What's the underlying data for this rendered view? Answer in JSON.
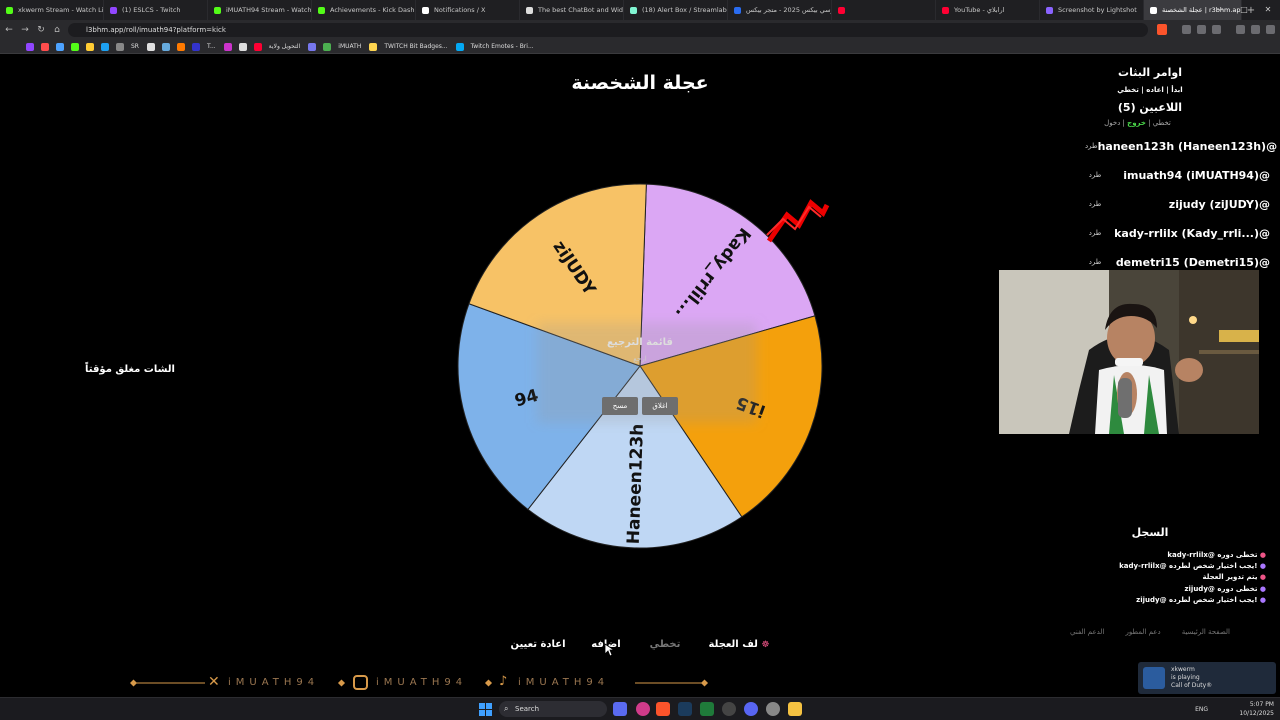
{
  "browser": {
    "tabs": [
      {
        "label": "xkwerm Stream - Watch Live",
        "color": "#53fc18"
      },
      {
        "label": "(1) ESLCS - Twitch",
        "color": "#9146ff"
      },
      {
        "label": "iMUATH94 Stream - Watch",
        "color": "#53fc18"
      },
      {
        "label": "Achievements - Kick Dashboard",
        "color": "#53fc18"
      },
      {
        "label": "Notifications / X",
        "color": "#ffffff"
      },
      {
        "label": "The best ChatBot and Widgets",
        "color": "#dddddd"
      },
      {
        "label": "(18) Alert Box / Streamlabs",
        "color": "#80f5d2"
      },
      {
        "label": "جيرسي بيكس 2025 - متجر بيكس",
        "color": "#2a6cf0"
      },
      {
        "label": "",
        "color": "#ff0033"
      },
      {
        "label": "YouTube - ارابلاي",
        "color": "#ff0033"
      },
      {
        "label": "Screenshot by Lightshot",
        "color": "#8a63ff"
      },
      {
        "label": "عجلة الشخصنة | r3bhm.app",
        "color": "#ffffff",
        "active": true
      }
    ],
    "url": "l3bhm.app/roll/imuath94?platform=kick",
    "bookmarks": [
      "SR",
      "T...",
      "التحويل ولاية",
      "iMUATH",
      "TWITCH Bit Badges...",
      "Twitch Emotes - Bri..."
    ]
  },
  "page": {
    "title": "عجلة الشخصنة",
    "chat_closed": "الشات مغلق مؤقتاً",
    "overlay_title": "قائمة الترجيع",
    "overlay_sub": "ارجع",
    "overlay_btn_clear": "مسح",
    "overlay_btn_close": "اغلاق"
  },
  "wheel": {
    "segments": [
      {
        "label": "Kady_rrlil...",
        "color": "#dba7f4",
        "blurred": false
      },
      {
        "label": "Demetri15",
        "display": "i15",
        "color": "#f4a00c",
        "blurred": true
      },
      {
        "label": "Haneen123h",
        "color": "#bfd7f4",
        "blurred": false
      },
      {
        "label": "iMUATH94",
        "display": "94",
        "color": "#7eb2ea",
        "blurred": true
      },
      {
        "label": "ziJUDY",
        "color": "#f7c266",
        "blurred": false
      }
    ]
  },
  "commands": {
    "title": "اوامر البثات",
    "list": "ابدأ | اعاده | تخطي"
  },
  "players": {
    "heading": "اللاعبين (5)",
    "sub_enter": "دخول",
    "sub_exit": "خروج",
    "sub_skip": "تخطي",
    "kick_label": "طرد",
    "items": [
      "haneen123h (Haneen123h)@",
      "imuath94 (iMUATH94)@",
      "zijudy (ziJUDY)@",
      "kady-rrlilx (Kady_rrli...)@",
      "demetri15 (Demetri15)@"
    ]
  },
  "log": {
    "title": "السجل",
    "lines": [
      "kady-rrlilx@ تخطى دوره",
      "kady-rrlilx@ يجب اختيار شخص لطرده!",
      "يتم تدوير العجلة",
      "zijudy@ تخطى دوره",
      "zijudy@ يجب اختيار شخص لطرده!"
    ]
  },
  "footer_links": [
    "الصفحة الرئيسية",
    "دعم المطور",
    "الدعم الفني"
  ],
  "controls": {
    "spin": "لف العجلة",
    "skip": "تخطي",
    "add": "اضافه",
    "reset": "اعادة تعيين"
  },
  "ticker": {
    "handle_x": "iMUATH94",
    "handle_ig": "iMUATH94",
    "handle_tt": "iMUATH94"
  },
  "toast": {
    "name": "xkwerm",
    "status": "is playing",
    "game": "Call of Duty®"
  },
  "taskbar": {
    "search": "Search",
    "lang": "ENG",
    "time": "5:07 PM",
    "date": "10/12/2025"
  }
}
